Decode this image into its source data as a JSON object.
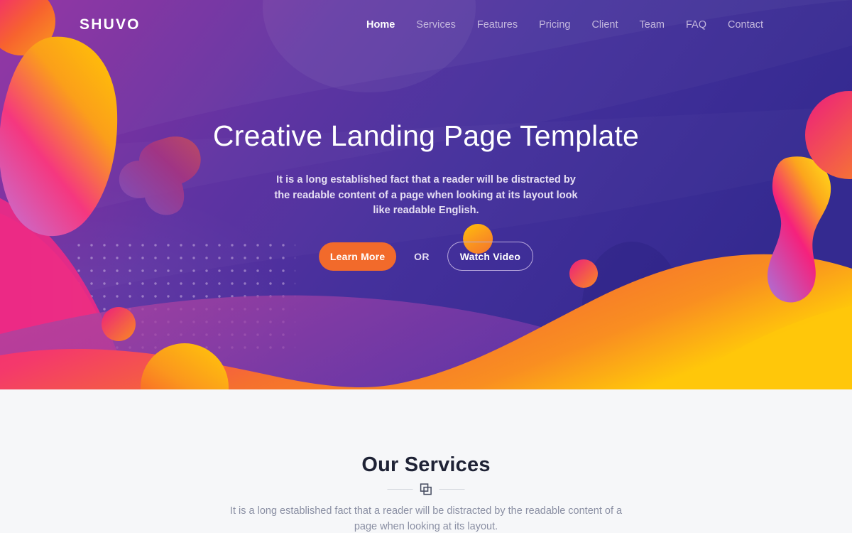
{
  "site": {
    "logo_text": "SHUVO",
    "accent_orange": "#f26a2b",
    "accent_yellow": "#ffc107",
    "accent_pink": "#ee2a7b",
    "hero_purple": "#5e2fa0",
    "hero_blue": "#362a91",
    "section_bg": "#f6f7f9",
    "heading_color": "#1e2235",
    "muted_text": "#8a8fa3"
  },
  "nav": {
    "items": [
      {
        "label": "Home",
        "active": true
      },
      {
        "label": "Services",
        "active": false
      },
      {
        "label": "Features",
        "active": false
      },
      {
        "label": "Pricing",
        "active": false
      },
      {
        "label": "Client",
        "active": false
      },
      {
        "label": "Team",
        "active": false
      },
      {
        "label": "FAQ",
        "active": false
      },
      {
        "label": "Contact",
        "active": false
      }
    ]
  },
  "hero": {
    "title": "Creative Landing Page Template",
    "subtitle": "It is a long established fact that a reader will be distracted by the readable content of a page when looking at its layout look like readable English.",
    "primary_button": "Learn More",
    "separator": "OR",
    "secondary_button": "Watch Video"
  },
  "services": {
    "title": "Our Services",
    "divider_icon": "clone-icon",
    "subtitle": "It is a long established fact that a reader will be distracted by the readable content of a page when looking at its layout."
  }
}
